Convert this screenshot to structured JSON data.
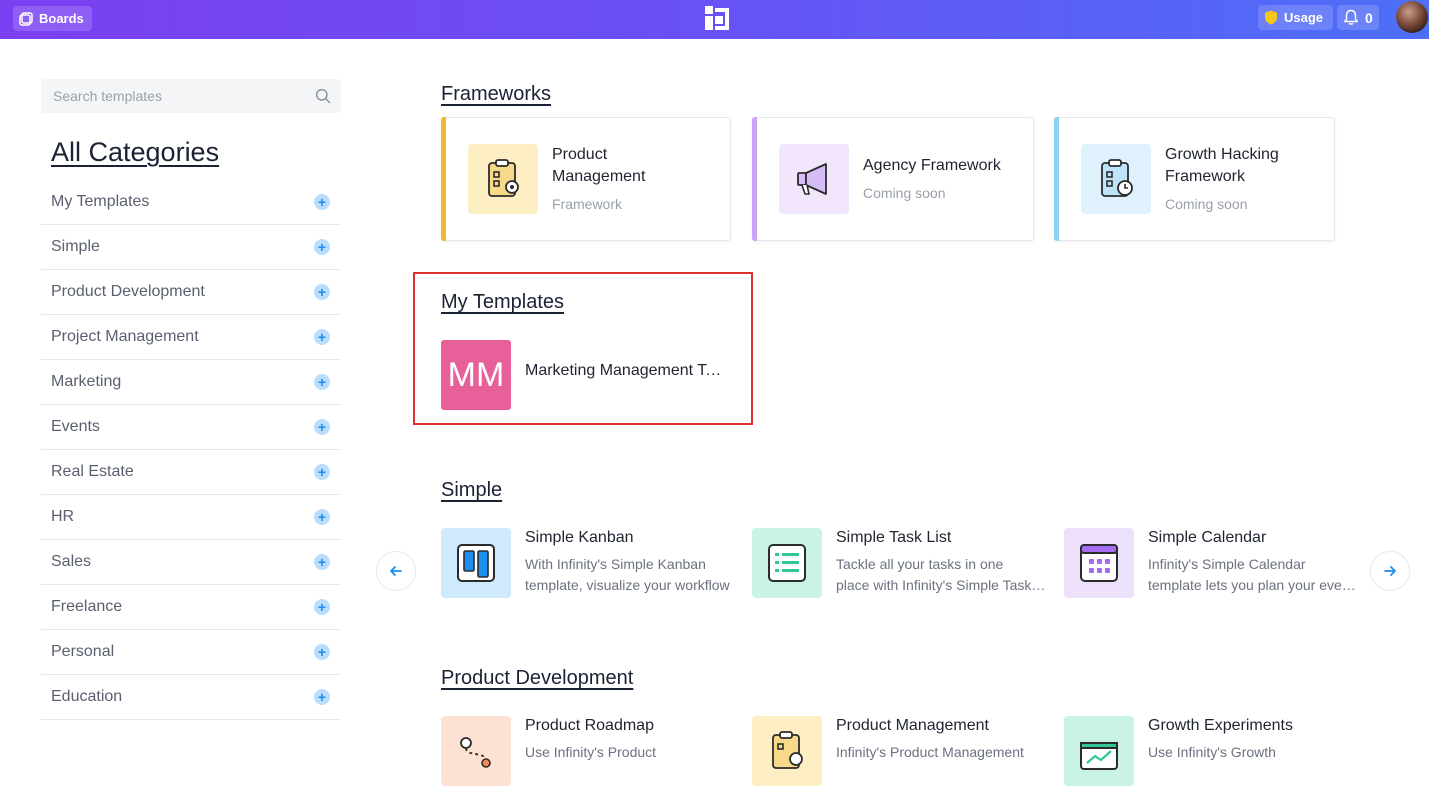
{
  "topbar": {
    "boards_label": "Boards",
    "usage_label": "Usage",
    "notifications_count": "0"
  },
  "sidebar": {
    "search_placeholder": "Search templates",
    "heading": "All Categories",
    "items": [
      {
        "label": "My Templates"
      },
      {
        "label": "Simple"
      },
      {
        "label": "Product Development"
      },
      {
        "label": "Project Management"
      },
      {
        "label": "Marketing"
      },
      {
        "label": "Events"
      },
      {
        "label": "Real Estate"
      },
      {
        "label": "HR"
      },
      {
        "label": "Sales"
      },
      {
        "label": "Freelance"
      },
      {
        "label": "Personal"
      },
      {
        "label": "Education"
      }
    ]
  },
  "frameworks": {
    "title": "Frameworks",
    "cards": [
      {
        "title_line1": "Product",
        "title_line2": "Management",
        "subtitle": "Framework",
        "accent": "#f5b731",
        "icon": "clipboard-gear-icon"
      },
      {
        "title_line1": "Agency Framework",
        "subtitle": "Coming soon",
        "accent": "#c9a6f5",
        "icon": "megaphone-icon"
      },
      {
        "title_line1": "Growth Hacking",
        "title_line2": "Framework",
        "subtitle": "Coming soon",
        "accent": "#8fd0f5",
        "icon": "clipboard-clock-icon"
      }
    ]
  },
  "my_templates": {
    "title": "My Templates",
    "items": [
      {
        "initials": "MM",
        "name": "Marketing Management Template",
        "color": "#e8609a"
      }
    ]
  },
  "simple": {
    "title": "Simple",
    "items": [
      {
        "name": "Simple Kanban",
        "desc_line1": "With Infinity's Simple Kanban",
        "desc_line2": "template, visualize your workflow",
        "icon": "kanban-icon"
      },
      {
        "name": "Simple Task List",
        "desc_line1": "Tackle all your tasks in one",
        "desc_line2": "place with Infinity's Simple Task List",
        "icon": "task-list-icon"
      },
      {
        "name": "Simple Calendar",
        "desc_line1": "Infinity's Simple Calendar",
        "desc_line2": "template lets you plan your events",
        "icon": "calendar-icon"
      }
    ]
  },
  "product_development": {
    "title": "Product Development",
    "items": [
      {
        "name": "Product Roadmap",
        "desc_line1": "Use Infinity's Product",
        "icon": "roadmap-icon"
      },
      {
        "name": "Product Management",
        "desc_line1": "Infinity's Product Management",
        "icon": "clipboard-gear-icon"
      },
      {
        "name": "Growth Experiments",
        "desc_line1": "Use Infinity's Growth",
        "icon": "growth-chart-icon"
      }
    ]
  }
}
